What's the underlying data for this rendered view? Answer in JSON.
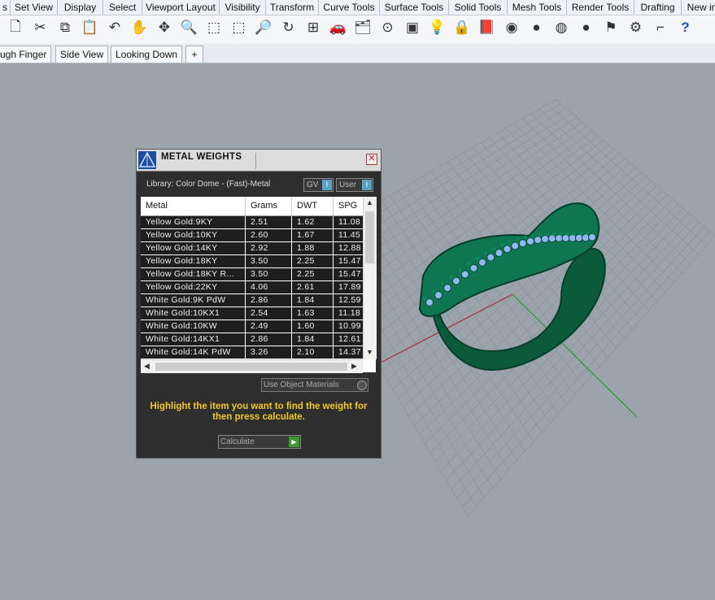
{
  "menu": [
    "s",
    "Set View",
    "Display",
    "Select",
    "Viewport Layout",
    "Visibility",
    "Transform",
    "Curve Tools",
    "Surface Tools",
    "Solid Tools",
    "Mesh Tools",
    "Render Tools",
    "Drafting",
    "New in"
  ],
  "toolbar_icons": [
    "new-document-icon",
    "cut-icon",
    "copy-icon",
    "paste-icon",
    "undo-icon",
    "pan-hand-icon",
    "rotate-view-icon",
    "zoom-icon",
    "zoom-window-icon",
    "zoom-extents-icon",
    "zoom-selected-icon",
    "rotate-3d-icon",
    "four-viewports-icon",
    "car-icon",
    "layer-icon",
    "point-icon",
    "properties-icon",
    "light-bulb-icon",
    "lock-icon",
    "layer-book-icon",
    "color-wheel-icon",
    "render-sphere-icon",
    "render-globe-icon",
    "blue-sphere-icon",
    "pointer-flag-icon",
    "gear-settings-icon",
    "dimension-icon",
    "help-icon"
  ],
  "view_tabs": [
    "ugh Finger",
    "Side View",
    "Looking Down",
    "+"
  ],
  "dialog": {
    "title": "METAL WEIGHTS",
    "close": "✕",
    "library_label": "Library: Color Dome - (Fast)-Metal",
    "gv_button": "GV",
    "user_button": "User",
    "toggle_mark": "I",
    "columns": [
      "Metal",
      "Grams",
      "DWT",
      "SPG"
    ],
    "rows": [
      [
        "Yellow Gold:9KY",
        "2.51",
        "1.62",
        "11.08"
      ],
      [
        "Yellow Gold:10KY",
        "2.60",
        "1.67",
        "11.45"
      ],
      [
        "Yellow Gold:14KY",
        "2.92",
        "1.88",
        "12.88"
      ],
      [
        "Yellow Gold:18KY",
        "3.50",
        "2.25",
        "15.47"
      ],
      [
        "Yellow Gold:18KY R...",
        "3.50",
        "2.25",
        "15.47"
      ],
      [
        "Yellow Gold:22KY",
        "4.06",
        "2.61",
        "17.89"
      ],
      [
        "White Gold:9K PdW",
        "2.86",
        "1.84",
        "12.59"
      ],
      [
        "White Gold:10KX1",
        "2.54",
        "1.63",
        "11.18"
      ],
      [
        "White Gold:10KW",
        "2.49",
        "1.60",
        "10.99"
      ],
      [
        "White Gold:14KX1",
        "2.86",
        "1.84",
        "12.61"
      ],
      [
        "White Gold:14K PdW",
        "3.26",
        "2.10",
        "14.37"
      ]
    ],
    "use_object_materials": "Use Object Materials",
    "hint": "Highlight the item you want to find the weight for then press calculate.",
    "calculate": "Calculate"
  },
  "colors": {
    "ring": "#0d6e4a",
    "stones": "#8fb7f0",
    "hint": "#f2c82c",
    "dialog_bg": "#2e2e2e"
  }
}
